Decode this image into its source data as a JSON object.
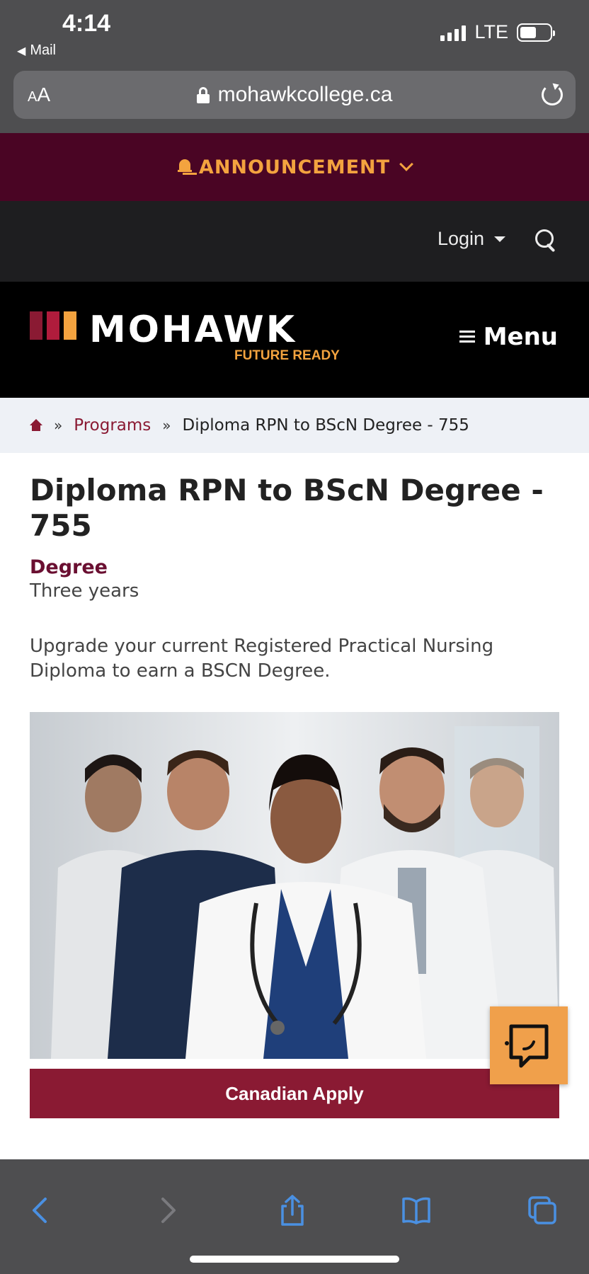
{
  "status_bar": {
    "time": "4:14",
    "back_app": "Mail",
    "network": "LTE"
  },
  "url_bar": {
    "aa_label": "AA",
    "url": "mohawkcollege.ca"
  },
  "announcement": {
    "label": "ANNOUNCEMENT"
  },
  "utility": {
    "login_label": "Login"
  },
  "header": {
    "logo_word": "MOHAWK",
    "logo_tagline": "FUTURE READY",
    "menu_label": "Menu",
    "logo_colors": [
      "#8a1a33",
      "#b01c3c",
      "#f3a33f"
    ]
  },
  "breadcrumb": {
    "items": [
      "Programs",
      "Diploma RPN to BScN Degree - 755"
    ],
    "separator": "»"
  },
  "program": {
    "title": "Diploma RPN to BScN Degree - 755",
    "credential": "Degree",
    "duration": "Three years",
    "description": "Upgrade your current Registered Practical Nursing Diploma to earn a BSCN Degree.",
    "image_alt": "Group of healthcare professionals in white coats and scrubs",
    "apply_label": "Canadian Apply"
  },
  "chat_widget": {
    "icon": "chat-icon",
    "color": "#f0a04b"
  },
  "colors": {
    "brand": "#8a1a33",
    "accent": "#f3a33f",
    "announcement_bg": "#4a0524"
  }
}
